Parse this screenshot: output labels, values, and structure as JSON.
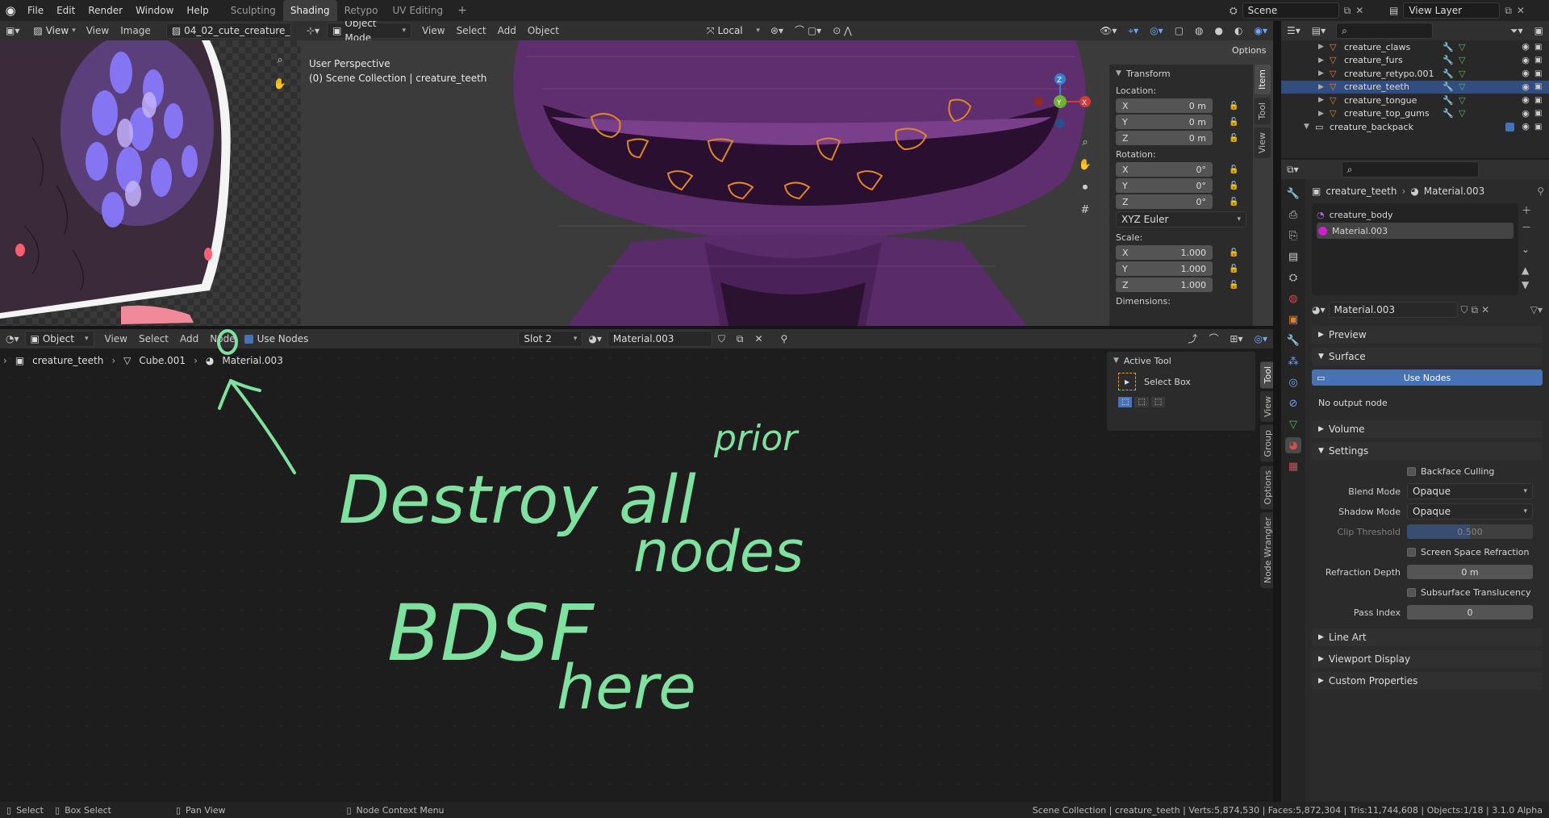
{
  "topbar": {
    "menus": [
      "File",
      "Edit",
      "Render",
      "Window",
      "Help"
    ],
    "workspaces": [
      "Sculpting",
      "Shading",
      "Retypo",
      "UV Editing"
    ],
    "active_workspace": "Shading",
    "add_tab": "+",
    "scene_label": "Scene",
    "view_layer_label": "View Layer"
  },
  "image_editor": {
    "view_menu": "View",
    "menus": [
      "View",
      "Image"
    ],
    "image_name": "04_02_cute_creature_t"
  },
  "viewport": {
    "mode": "Object Mode",
    "menus": [
      "View",
      "Select",
      "Add",
      "Object"
    ],
    "orientation": "Local",
    "options_label": "Options",
    "perspective": "User Perspective",
    "collection_info": "(0) Scene Collection | creature_teeth",
    "gizmo": {
      "x": "X",
      "y": "Y",
      "z": "Z"
    }
  },
  "transform": {
    "title": "Transform",
    "location_label": "Location:",
    "location": [
      {
        "axis": "X",
        "value": "0 m"
      },
      {
        "axis": "Y",
        "value": "0 m"
      },
      {
        "axis": "Z",
        "value": "0 m"
      }
    ],
    "rotation_label": "Rotation:",
    "rotation": [
      {
        "axis": "X",
        "value": "0°"
      },
      {
        "axis": "Y",
        "value": "0°"
      },
      {
        "axis": "Z",
        "value": "0°"
      }
    ],
    "rotation_mode": "XYZ Euler",
    "scale_label": "Scale:",
    "scale": [
      {
        "axis": "X",
        "value": "1.000"
      },
      {
        "axis": "Y",
        "value": "1.000"
      },
      {
        "axis": "Z",
        "value": "1.000"
      }
    ],
    "dimensions_label": "Dimensions:"
  },
  "viewport_tabs": [
    "Item",
    "Tool",
    "View"
  ],
  "outliner": {
    "items": [
      {
        "name": "creature_claws",
        "selected": false
      },
      {
        "name": "creature_furs",
        "selected": false
      },
      {
        "name": "creature_retypo.001",
        "selected": false
      },
      {
        "name": "creature_teeth",
        "selected": true
      },
      {
        "name": "creature_tongue",
        "selected": false
      },
      {
        "name": "creature_top_gums",
        "selected": false
      }
    ],
    "collection": "creature_backpack"
  },
  "node_editor": {
    "editor_type": "Object",
    "menus": [
      "View",
      "Select",
      "Add",
      "Node"
    ],
    "use_nodes_label": "Use Nodes",
    "slot": "Slot 2",
    "material": "Material.003",
    "breadcrumb": [
      "creature_teeth",
      "Cube.001",
      "Material.003"
    ],
    "annotation": {
      "line1a": "Destroy all",
      "line1b": "prior",
      "line2a": "BDSF",
      "line2b": "nodes",
      "line3": "here"
    }
  },
  "active_tool": {
    "title": "Active Tool",
    "tool_name": "Select Box"
  },
  "node_tabs": [
    "Tool",
    "View",
    "Group",
    "Options",
    "Node Wrangler"
  ],
  "properties": {
    "breadcrumb_object": "creature_teeth",
    "breadcrumb_material": "Material.003",
    "slots": [
      "creature_body",
      "Material.003"
    ],
    "material_name": "Material.003",
    "sections": {
      "preview": "Preview",
      "surface": "Surface",
      "use_nodes_button": "Use Nodes",
      "no_output": "No output node",
      "volume": "Volume",
      "settings": "Settings",
      "backface_culling": "Backface Culling",
      "blend_mode_label": "Blend Mode",
      "blend_mode": "Opaque",
      "shadow_mode_label": "Shadow Mode",
      "shadow_mode": "Opaque",
      "clip_threshold_label": "Clip Threshold",
      "clip_threshold": "0.500",
      "screen_space_refraction": "Screen Space Refraction",
      "refraction_depth_label": "Refraction Depth",
      "refraction_depth": "0 m",
      "subsurface_translucency": "Subsurface Translucency",
      "pass_index_label": "Pass Index",
      "pass_index": "0",
      "line_art": "Line Art",
      "viewport_display": "Viewport Display",
      "custom_properties": "Custom Properties"
    }
  },
  "statusbar": {
    "select": "Select",
    "box_select": "Box Select",
    "pan_view": "Pan View",
    "context_menu": "Node Context Menu",
    "stats": "Scene Collection | creature_teeth | Verts:5,874,530 | Faces:5,872,304 | Tris:11,744,608 | Objects:1/18 | 3.1.0 Alpha"
  },
  "colors": {
    "accent": "#4772b3",
    "annotation": "#7fe0a0",
    "selection_outline": "#e0862a",
    "material_dot": "#d01fd0"
  }
}
